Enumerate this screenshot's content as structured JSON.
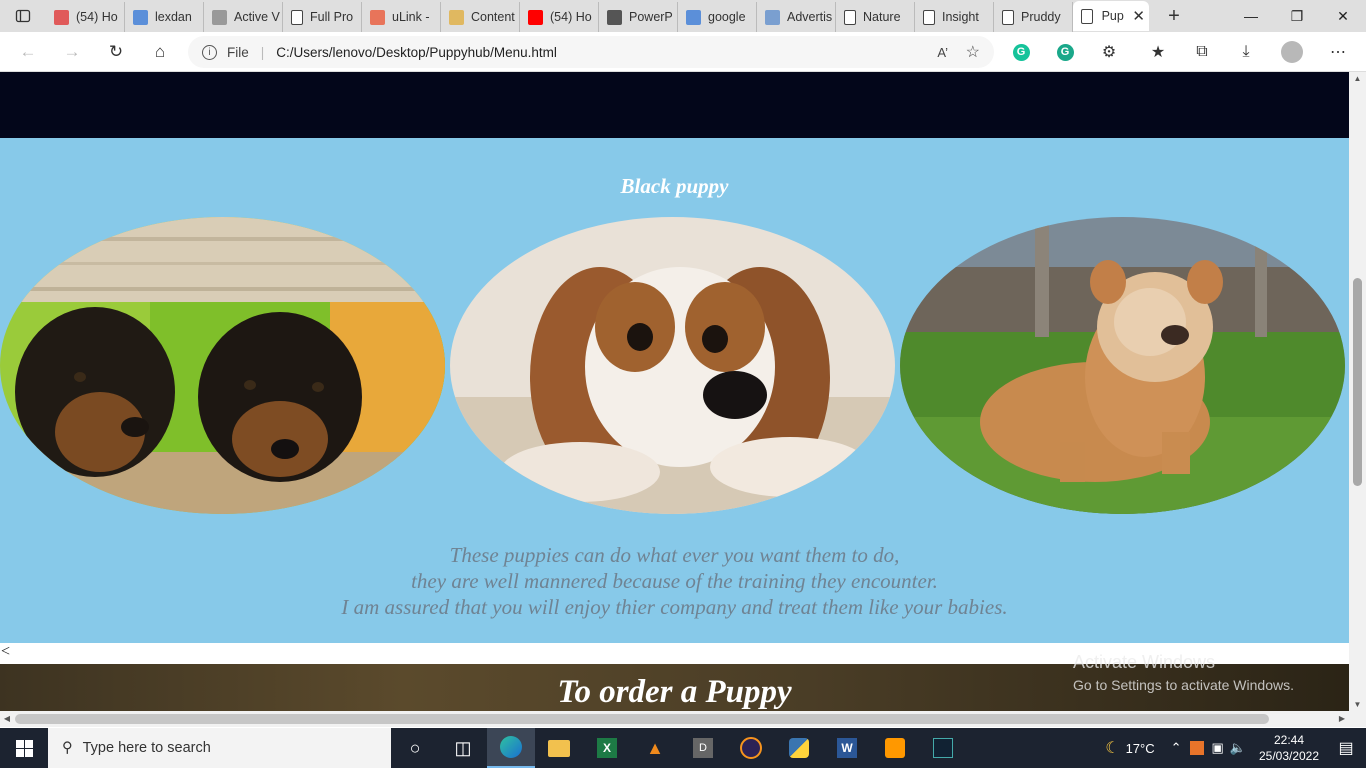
{
  "browser": {
    "tabs": [
      {
        "label": "(54) Ho",
        "icon": "youtube-icon",
        "color": "#e05a5a"
      },
      {
        "label": "lexdan",
        "icon": "bing-icon",
        "color": "#5b8fd9"
      },
      {
        "label": "Active V",
        "icon": "link-icon",
        "color": "#999999"
      },
      {
        "label": "Full Pro",
        "icon": "page-icon",
        "color": "#ffffff"
      },
      {
        "label": "uLink -",
        "icon": "ulink-icon",
        "color": "#e8745a"
      },
      {
        "label": "Content",
        "icon": "content-icon",
        "color": "#e0b860"
      },
      {
        "label": "(54) Ho",
        "icon": "youtube-icon",
        "color": "#ff0000"
      },
      {
        "label": "PowerP",
        "icon": "bb-icon",
        "color": "#555555"
      },
      {
        "label": "google",
        "icon": "bing-icon",
        "color": "#5b8fd9"
      },
      {
        "label": "Advertis",
        "icon": "advert-icon",
        "color": "#7a9fd0"
      },
      {
        "label": "Nature",
        "icon": "page-icon",
        "color": "#ffffff"
      },
      {
        "label": "Insight",
        "icon": "page-icon",
        "color": "#ffffff"
      },
      {
        "label": "Pruddy",
        "icon": "page-icon",
        "color": "#ffffff"
      }
    ],
    "active_tab": {
      "label": "Pup",
      "close": "✕"
    },
    "new_tab": "+",
    "address": {
      "scheme": "File",
      "url": "C:/Users/lenovo/Desktop/Puppyhub/Menu.html"
    }
  },
  "page": {
    "section_title": "Black puppy",
    "description_lines": [
      "These puppies can do what ever you want them to do,",
      "they are well mannered because of the training they encounter.",
      "I am assured that you will enjoy thier company and treat them like your babies."
    ],
    "stray_text": "<",
    "order_title": "To order a Puppy",
    "colors": {
      "dark_band": "#03061a",
      "blue_band": "#87c9e9",
      "description": "#6f8393"
    }
  },
  "watermark": {
    "line1": "Activate Windows",
    "line2": "Go to Settings to activate Windows."
  },
  "taskbar": {
    "search_placeholder": "Type here to search",
    "weather": "17°C",
    "time": "22:44",
    "date": "25/03/2022"
  }
}
